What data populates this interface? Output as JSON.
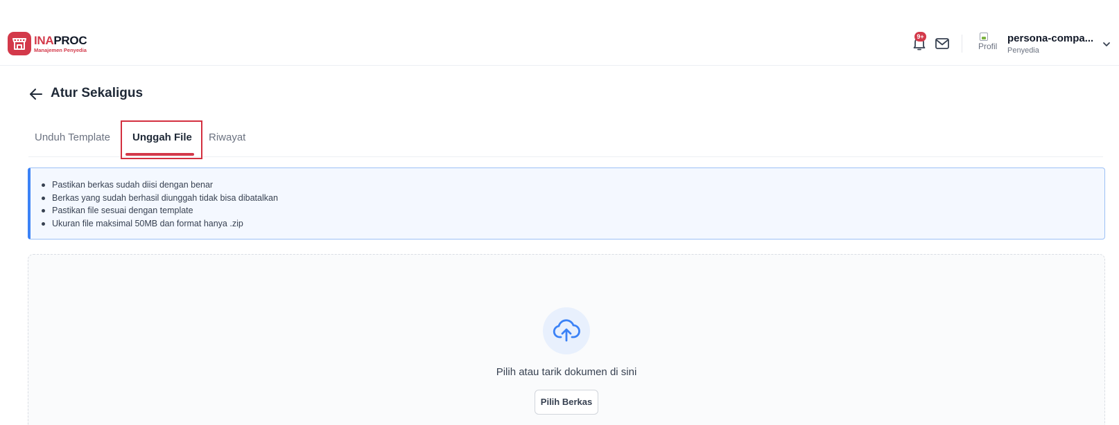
{
  "header": {
    "logo_title_red": "INA",
    "logo_title_dark": "PROC",
    "logo_subtitle": "Manajemen Penyedia",
    "notification_badge": "9+",
    "avatar_alt": "Profil",
    "user_name": "persona-compa...",
    "user_role": "Penyedia"
  },
  "page": {
    "title": "Atur Sekaligus"
  },
  "tabs": [
    {
      "label": "Unduh Template",
      "active": false
    },
    {
      "label": "Unggah File",
      "active": true
    },
    {
      "label": "Riwayat",
      "active": false
    }
  ],
  "info": {
    "items": [
      "Pastikan berkas sudah diisi dengan benar",
      "Berkas yang sudah berhasil diunggah tidak bisa dibatalkan",
      "Pastikan file sesuai dengan template",
      "Ukuran file maksimal 50MB dan format hanya .zip"
    ]
  },
  "dropzone": {
    "text": "Pilih atau tarik dokumen di sini",
    "button_label": "Pilih Berkas"
  },
  "colors": {
    "brand": "#d3394a",
    "info_accent": "#3b82f6",
    "highlight": "#d32f3f"
  }
}
